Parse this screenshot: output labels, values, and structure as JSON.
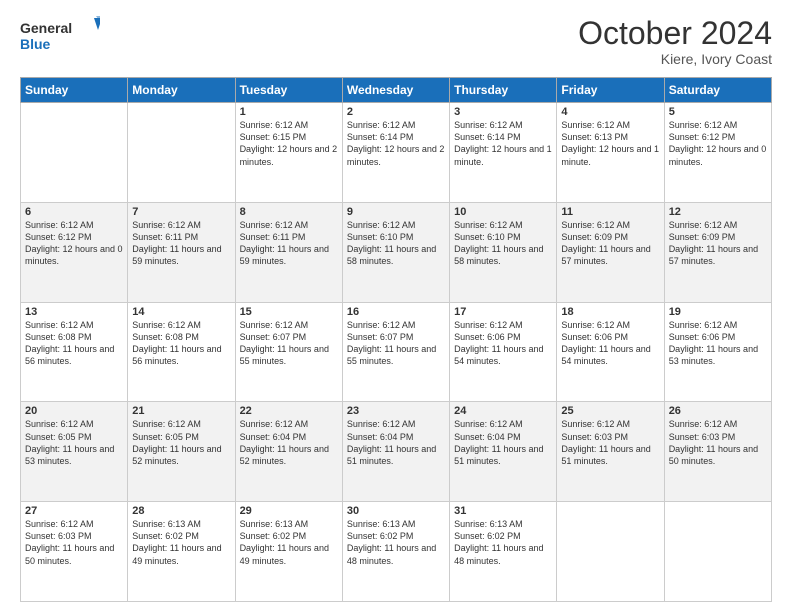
{
  "logo": {
    "line1": "General",
    "line2": "Blue"
  },
  "title": "October 2024",
  "subtitle": "Kiere, Ivory Coast",
  "days_of_week": [
    "Sunday",
    "Monday",
    "Tuesday",
    "Wednesday",
    "Thursday",
    "Friday",
    "Saturday"
  ],
  "weeks": [
    [
      {
        "day": "",
        "info": ""
      },
      {
        "day": "",
        "info": ""
      },
      {
        "day": "1",
        "info": "Sunrise: 6:12 AM\nSunset: 6:15 PM\nDaylight: 12 hours and 2 minutes."
      },
      {
        "day": "2",
        "info": "Sunrise: 6:12 AM\nSunset: 6:14 PM\nDaylight: 12 hours and 2 minutes."
      },
      {
        "day": "3",
        "info": "Sunrise: 6:12 AM\nSunset: 6:14 PM\nDaylight: 12 hours and 1 minute."
      },
      {
        "day": "4",
        "info": "Sunrise: 6:12 AM\nSunset: 6:13 PM\nDaylight: 12 hours and 1 minute."
      },
      {
        "day": "5",
        "info": "Sunrise: 6:12 AM\nSunset: 6:12 PM\nDaylight: 12 hours and 0 minutes."
      }
    ],
    [
      {
        "day": "6",
        "info": "Sunrise: 6:12 AM\nSunset: 6:12 PM\nDaylight: 12 hours and 0 minutes."
      },
      {
        "day": "7",
        "info": "Sunrise: 6:12 AM\nSunset: 6:11 PM\nDaylight: 11 hours and 59 minutes."
      },
      {
        "day": "8",
        "info": "Sunrise: 6:12 AM\nSunset: 6:11 PM\nDaylight: 11 hours and 59 minutes."
      },
      {
        "day": "9",
        "info": "Sunrise: 6:12 AM\nSunset: 6:10 PM\nDaylight: 11 hours and 58 minutes."
      },
      {
        "day": "10",
        "info": "Sunrise: 6:12 AM\nSunset: 6:10 PM\nDaylight: 11 hours and 58 minutes."
      },
      {
        "day": "11",
        "info": "Sunrise: 6:12 AM\nSunset: 6:09 PM\nDaylight: 11 hours and 57 minutes."
      },
      {
        "day": "12",
        "info": "Sunrise: 6:12 AM\nSunset: 6:09 PM\nDaylight: 11 hours and 57 minutes."
      }
    ],
    [
      {
        "day": "13",
        "info": "Sunrise: 6:12 AM\nSunset: 6:08 PM\nDaylight: 11 hours and 56 minutes."
      },
      {
        "day": "14",
        "info": "Sunrise: 6:12 AM\nSunset: 6:08 PM\nDaylight: 11 hours and 56 minutes."
      },
      {
        "day": "15",
        "info": "Sunrise: 6:12 AM\nSunset: 6:07 PM\nDaylight: 11 hours and 55 minutes."
      },
      {
        "day": "16",
        "info": "Sunrise: 6:12 AM\nSunset: 6:07 PM\nDaylight: 11 hours and 55 minutes."
      },
      {
        "day": "17",
        "info": "Sunrise: 6:12 AM\nSunset: 6:06 PM\nDaylight: 11 hours and 54 minutes."
      },
      {
        "day": "18",
        "info": "Sunrise: 6:12 AM\nSunset: 6:06 PM\nDaylight: 11 hours and 54 minutes."
      },
      {
        "day": "19",
        "info": "Sunrise: 6:12 AM\nSunset: 6:06 PM\nDaylight: 11 hours and 53 minutes."
      }
    ],
    [
      {
        "day": "20",
        "info": "Sunrise: 6:12 AM\nSunset: 6:05 PM\nDaylight: 11 hours and 53 minutes."
      },
      {
        "day": "21",
        "info": "Sunrise: 6:12 AM\nSunset: 6:05 PM\nDaylight: 11 hours and 52 minutes."
      },
      {
        "day": "22",
        "info": "Sunrise: 6:12 AM\nSunset: 6:04 PM\nDaylight: 11 hours and 52 minutes."
      },
      {
        "day": "23",
        "info": "Sunrise: 6:12 AM\nSunset: 6:04 PM\nDaylight: 11 hours and 51 minutes."
      },
      {
        "day": "24",
        "info": "Sunrise: 6:12 AM\nSunset: 6:04 PM\nDaylight: 11 hours and 51 minutes."
      },
      {
        "day": "25",
        "info": "Sunrise: 6:12 AM\nSunset: 6:03 PM\nDaylight: 11 hours and 51 minutes."
      },
      {
        "day": "26",
        "info": "Sunrise: 6:12 AM\nSunset: 6:03 PM\nDaylight: 11 hours and 50 minutes."
      }
    ],
    [
      {
        "day": "27",
        "info": "Sunrise: 6:12 AM\nSunset: 6:03 PM\nDaylight: 11 hours and 50 minutes."
      },
      {
        "day": "28",
        "info": "Sunrise: 6:13 AM\nSunset: 6:02 PM\nDaylight: 11 hours and 49 minutes."
      },
      {
        "day": "29",
        "info": "Sunrise: 6:13 AM\nSunset: 6:02 PM\nDaylight: 11 hours and 49 minutes."
      },
      {
        "day": "30",
        "info": "Sunrise: 6:13 AM\nSunset: 6:02 PM\nDaylight: 11 hours and 48 minutes."
      },
      {
        "day": "31",
        "info": "Sunrise: 6:13 AM\nSunset: 6:02 PM\nDaylight: 11 hours and 48 minutes."
      },
      {
        "day": "",
        "info": ""
      },
      {
        "day": "",
        "info": ""
      }
    ]
  ],
  "accent_color": "#1a6fba"
}
